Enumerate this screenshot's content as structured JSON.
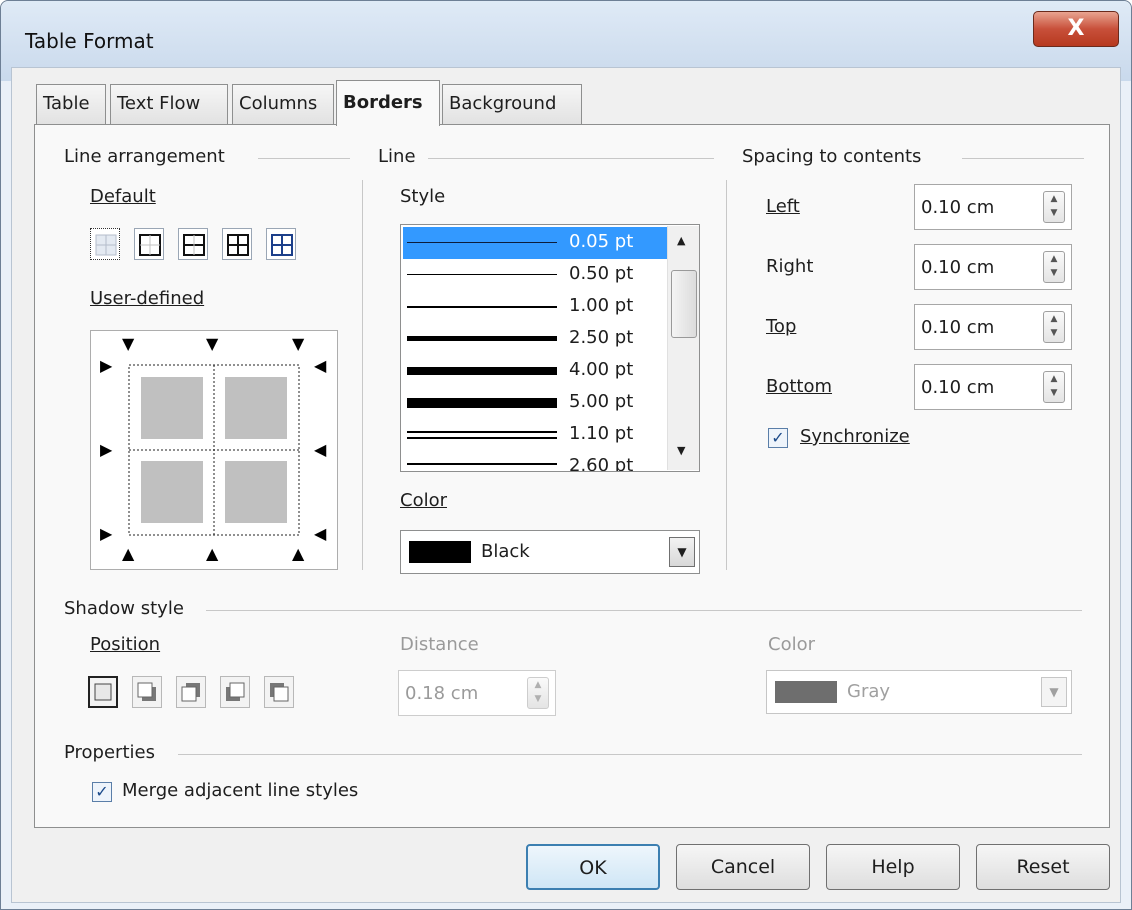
{
  "window": {
    "title": "Table Format",
    "close_glyph": "X"
  },
  "tabs": [
    {
      "label": "Table"
    },
    {
      "label": "Text Flow"
    },
    {
      "label": "Columns"
    },
    {
      "label": "Borders",
      "active": true
    },
    {
      "label": "Background"
    }
  ],
  "line_arrangement": {
    "heading": "Line arrangement",
    "default_label": "Default",
    "user_defined_label": "User-defined"
  },
  "line": {
    "heading": "Line",
    "style_label": "Style",
    "styles": [
      {
        "value": "0.05 pt",
        "selected": true
      },
      {
        "value": "0.50 pt"
      },
      {
        "value": "1.00 pt"
      },
      {
        "value": "2.50 pt"
      },
      {
        "value": "4.00 pt"
      },
      {
        "value": "5.00 pt"
      },
      {
        "value": "1.10 pt"
      },
      {
        "value": "2.60 pt"
      }
    ],
    "color_label": "Color",
    "color_value": "Black",
    "color_swatch": "#000000"
  },
  "spacing": {
    "heading": "Spacing to contents",
    "left_label": "Left",
    "left_value": "0.10 cm",
    "right_label": "Right",
    "right_value": "0.10 cm",
    "top_label": "Top",
    "top_value": "0.10 cm",
    "bottom_label": "Bottom",
    "bottom_value": "0.10 cm",
    "synchronize_label": "Synchronize",
    "synchronize_checked": true
  },
  "shadow": {
    "heading": "Shadow style",
    "position_label": "Position",
    "distance_label": "Distance",
    "distance_value": "0.18 cm",
    "color_label": "Color",
    "color_value": "Gray",
    "color_swatch": "#6e6e6e"
  },
  "properties": {
    "heading": "Properties",
    "merge_label": "Merge adjacent line styles",
    "merge_checked": true
  },
  "buttons": {
    "ok": "OK",
    "cancel": "Cancel",
    "help": "Help",
    "reset": "Reset"
  },
  "glyphs": {
    "check": "✓",
    "spin_up": "▲",
    "spin_down": "▼",
    "dropdown": "▼",
    "scroll_up": "▲",
    "scroll_down": "▼"
  },
  "colors": {
    "selection": "#3399ff",
    "title_close": "#c8503a"
  }
}
